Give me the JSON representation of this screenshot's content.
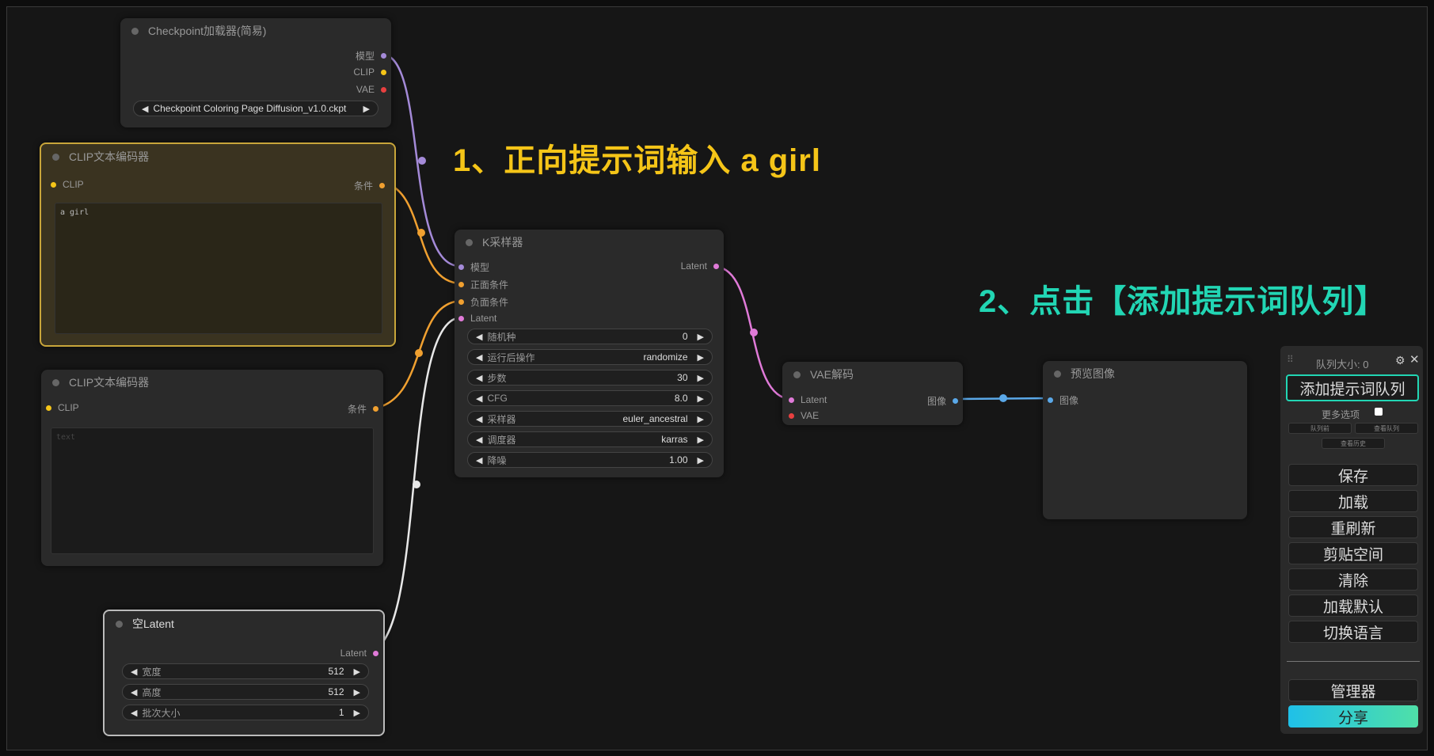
{
  "annotations": {
    "step1": "1、正向提示词输入 a girl",
    "step2": "2、点击【添加提示词队列】"
  },
  "colors": {
    "annotation1": "#f5c518",
    "annotation2": "#22d6b4",
    "model_wire": "#a48ad8",
    "clip_wire": "#f0a030",
    "latent_wire": "#e07ad8",
    "image_wire": "#5aa8e8",
    "selected_border": "#c8a53a"
  },
  "checkpoint_node": {
    "title": "Checkpoint加载器(简易)",
    "outputs": [
      "模型",
      "CLIP",
      "VAE"
    ],
    "ckpt_value": "Checkpoint Coloring Page Diffusion_v1.0.ckpt"
  },
  "clip_pos_node": {
    "title": "CLIP文本编码器",
    "input": "CLIP",
    "output": "条件",
    "text": "a girl"
  },
  "clip_neg_node": {
    "title": "CLIP文本编码器",
    "input": "CLIP",
    "output": "条件",
    "text": "text"
  },
  "latent_node": {
    "title": "空Latent",
    "output": "Latent",
    "widgets": [
      {
        "label": "宽度",
        "value": "512"
      },
      {
        "label": "高度",
        "value": "512"
      },
      {
        "label": "批次大小",
        "value": "1"
      }
    ]
  },
  "ksampler_node": {
    "title": "K采样器",
    "inputs": [
      "模型",
      "正面条件",
      "负面条件",
      "Latent"
    ],
    "output": "Latent",
    "widgets": [
      {
        "label": "随机种",
        "value": "0"
      },
      {
        "label": "运行后操作",
        "value": "randomize"
      },
      {
        "label": "步数",
        "value": "30"
      },
      {
        "label": "CFG",
        "value": "8.0"
      },
      {
        "label": "采样器",
        "value": "euler_ancestral"
      },
      {
        "label": "调度器",
        "value": "karras"
      },
      {
        "label": "降噪",
        "value": "1.00"
      }
    ]
  },
  "vae_node": {
    "title": "VAE解码",
    "inputs": [
      "Latent",
      "VAE"
    ],
    "output": "图像"
  },
  "preview_node": {
    "title": "预览图像",
    "input": "图像"
  },
  "panel": {
    "queue_size": "队列大小: 0",
    "queue_button": "添加提示词队列",
    "more_options": "更多选项",
    "tiny_buttons": [
      "队列前",
      "查看队列",
      "查看历史"
    ],
    "buttons": [
      "保存",
      "加载",
      "重刷新",
      "剪贴空间",
      "清除",
      "加载默认",
      "切换语言"
    ],
    "manager": "管理器",
    "share": "分享"
  }
}
